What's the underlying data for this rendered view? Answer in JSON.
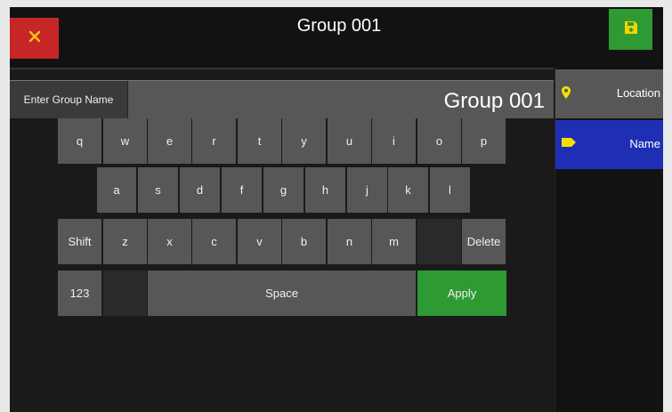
{
  "header": {
    "title": "Group 001",
    "close_icon": "close-icon",
    "save_icon": "save-icon",
    "colors": {
      "close": "#c62626",
      "save": "#2e9a33",
      "close_glyph": "#f5c518",
      "save_glyph": "#f5d400"
    }
  },
  "name_field": {
    "label": "Enter Group Name",
    "value": "Group 001"
  },
  "keyboard": {
    "row1": [
      "q",
      "w",
      "e",
      "r",
      "t",
      "y",
      "u",
      "i",
      "o",
      "p"
    ],
    "row2": [
      "a",
      "s",
      "d",
      "f",
      "g",
      "h",
      "j",
      "k",
      "l"
    ],
    "row3": [
      "Shift",
      "z",
      "x",
      "c",
      "v",
      "b",
      "n",
      "m",
      "",
      "Delete"
    ],
    "row4": [
      "123",
      "",
      "Space",
      "Apply"
    ]
  },
  "side_tabs": [
    {
      "label": "Location",
      "icon": "location-pin-icon",
      "active": false
    },
    {
      "label": "Name",
      "icon": "tag-icon",
      "active": true
    }
  ],
  "colors": {
    "active_tab": "#1f2fb5",
    "inactive_tab": "#575757",
    "apply": "#2e9a33",
    "icon_yellow": "#f5e000"
  }
}
